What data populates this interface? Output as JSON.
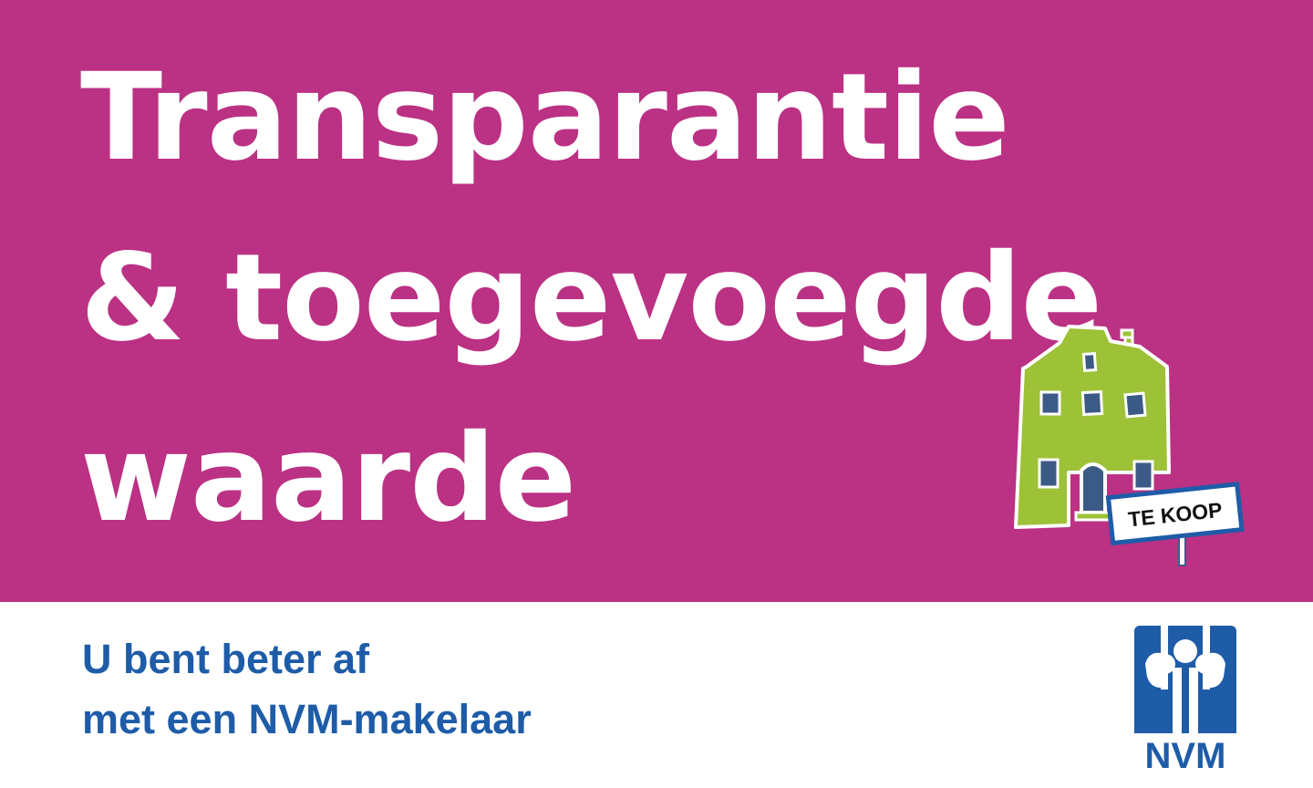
{
  "colors": {
    "banner": "#bb3184",
    "headline": "#ffffff",
    "tagline": "#1e5ca8",
    "house": "#9dc137",
    "window": "#3c5a86",
    "logo": "#1e5ca8"
  },
  "headline": {
    "line1": "Transparantie",
    "line2": "& toegevoegde",
    "line3": "waarde"
  },
  "house": {
    "icon": "house-icon",
    "sign_text": "TE KOOP"
  },
  "tagline": {
    "line1": "U bent beter af",
    "line2": "met een NVM-makelaar"
  },
  "logo": {
    "icon": "nvm-logo",
    "text": "NVM"
  }
}
